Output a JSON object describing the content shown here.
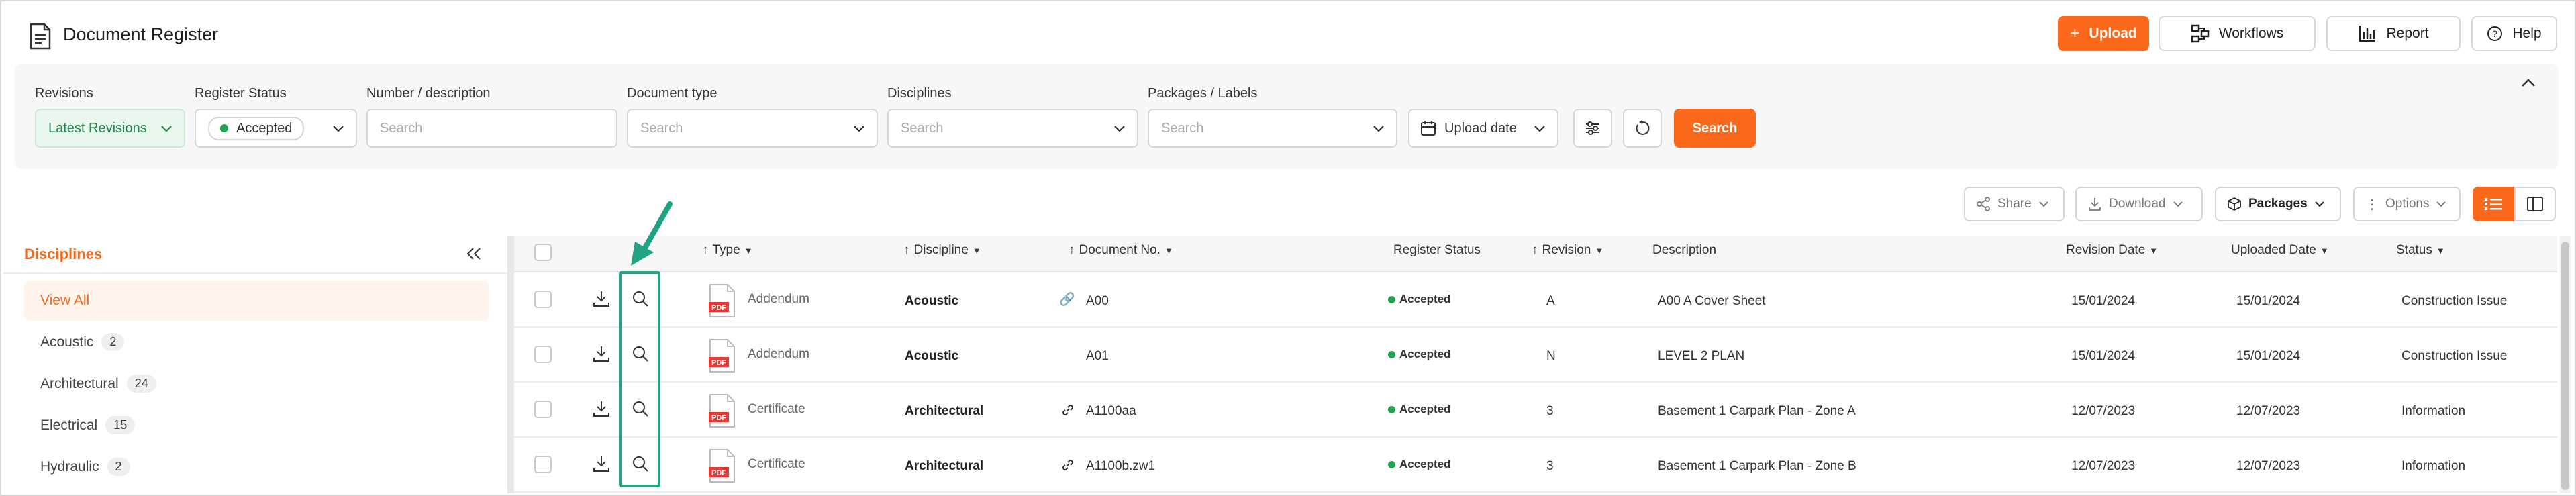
{
  "header": {
    "title": "Document Register",
    "buttons": {
      "upload": "Upload",
      "workflows": "Workflows",
      "report": "Report",
      "help": "Help"
    }
  },
  "filters": {
    "labels": {
      "revisions": "Revisions",
      "register_status": "Register Status",
      "number_description": "Number / description",
      "document_type": "Document type",
      "disciplines": "Disciplines",
      "packages_labels": "Packages / Labels"
    },
    "revisions_value": "Latest Revisions",
    "register_status_value": "Accepted",
    "number_placeholder": "Search",
    "document_type_placeholder": "Search",
    "disciplines_placeholder": "Search",
    "packages_placeholder": "Search",
    "upload_date": "Upload date",
    "search_button": "Search"
  },
  "toolbar": {
    "share": "Share",
    "download": "Download",
    "packages": "Packages",
    "options": "Options"
  },
  "sidebar": {
    "title": "Disciplines",
    "view_all": "View All",
    "items": [
      {
        "label": "Acoustic",
        "count": "2"
      },
      {
        "label": "Architectural",
        "count": "24"
      },
      {
        "label": "Electrical",
        "count": "15"
      },
      {
        "label": "Hydraulic",
        "count": "2"
      }
    ]
  },
  "table": {
    "columns": {
      "type": "Type",
      "discipline": "Discipline",
      "document_no": "Document No.",
      "register_status": "Register Status",
      "revision": "Revision",
      "description": "Description",
      "revision_date": "Revision Date",
      "uploaded_date": "Uploaded Date",
      "status": "Status"
    },
    "rows": [
      {
        "type": "Addendum",
        "discipline": "Acoustic",
        "document_no": "A00",
        "register_status": "Accepted",
        "revision": "A",
        "description": "A00 A Cover Sheet",
        "revision_date": "15/01/2024",
        "uploaded_date": "15/01/2024",
        "status": "Construction Issue"
      },
      {
        "type": "Addendum",
        "discipline": "Acoustic",
        "document_no": "A01",
        "register_status": "Accepted",
        "revision": "N",
        "description": "LEVEL 2 PLAN",
        "revision_date": "15/01/2024",
        "uploaded_date": "15/01/2024",
        "status": "Construction Issue"
      },
      {
        "type": "Certificate",
        "discipline": "Architectural",
        "document_no": "A1100aa",
        "register_status": "Accepted",
        "revision": "3",
        "description": "Basement 1 Carpark Plan - Zone A",
        "revision_date": "12/07/2023",
        "uploaded_date": "12/07/2023",
        "status": "Information"
      },
      {
        "type": "Certificate",
        "discipline": "Architectural",
        "document_no": "A1100b.zw1",
        "register_status": "Accepted",
        "revision": "3",
        "description": "Basement 1 Carpark Plan - Zone B",
        "revision_date": "12/07/2023",
        "uploaded_date": "12/07/2023",
        "status": "Information"
      }
    ],
    "pdf_label": "PDF"
  },
  "colors": {
    "accent": "#fb6a1c",
    "accepted": "#22a352",
    "highlight": "#1fa383"
  }
}
